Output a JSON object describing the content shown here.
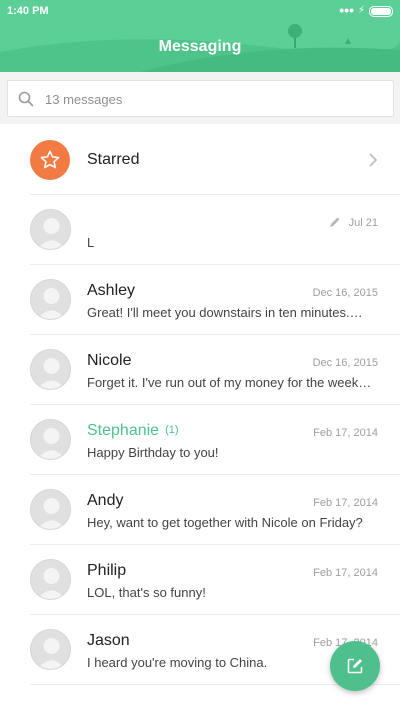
{
  "status_bar": {
    "time": "1:40 PM",
    "signal_dots": "•••"
  },
  "header": {
    "title": "Messaging"
  },
  "search": {
    "placeholder": "13 messages"
  },
  "starred": {
    "label": "Starred"
  },
  "conversations": [
    {
      "name": "",
      "count": "",
      "date": "Jul 21",
      "preview": "L",
      "draft": true
    },
    {
      "name": "Ashley",
      "count": "",
      "date": "Dec 16, 2015",
      "preview": "Great! I'll meet you downstairs in ten minutes.…"
    },
    {
      "name": "Nicole",
      "count": "",
      "date": "Dec 16, 2015",
      "preview": "Forget it. I've run out of my money for the week…"
    },
    {
      "name": "Stephanie",
      "count": "(1)",
      "date": "Feb 17, 2014",
      "preview": "Happy Birthday to you!",
      "unread": true
    },
    {
      "name": "Andy",
      "count": "",
      "date": "Feb 17, 2014",
      "preview": "Hey, want to get together with Nicole on Friday?"
    },
    {
      "name": "Philip",
      "count": "",
      "date": "Feb 17, 2014",
      "preview": "LOL, that's so funny!"
    },
    {
      "name": "Jason",
      "count": "",
      "date": "Feb 17, 2014",
      "preview": "I heard you're moving to China."
    }
  ],
  "colors": {
    "accent": "#4fc08d",
    "header": "#5bcf96",
    "starred_badge": "#f27a43"
  },
  "icons": {
    "search": "search-icon",
    "star": "star-icon",
    "chevron": "chevron-right-icon",
    "draft": "pencil-icon",
    "compose": "compose-icon",
    "avatar": "person-icon"
  }
}
